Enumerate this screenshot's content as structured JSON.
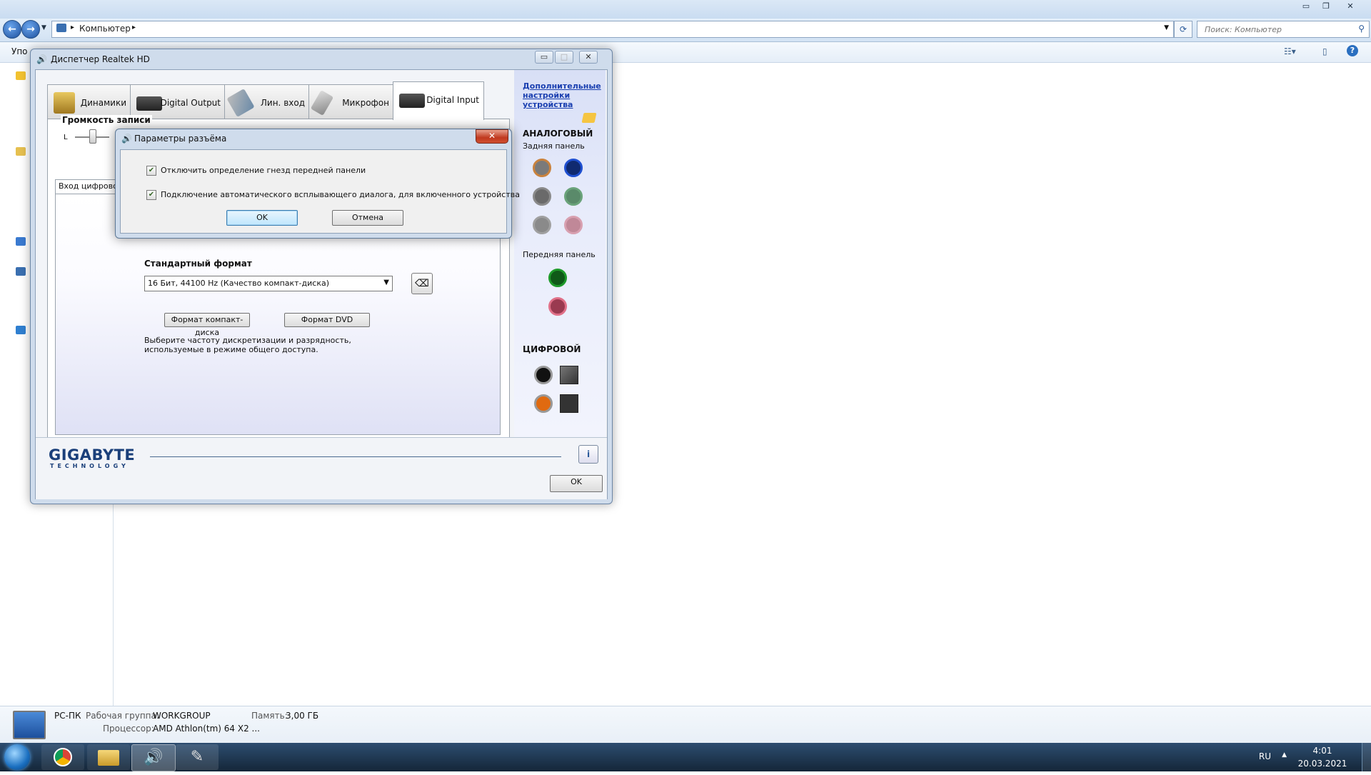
{
  "explorer": {
    "breadcrumb": "Компьютер",
    "search_placeholder": "Поиск: Компьютер",
    "command_partial": "Упо",
    "computer_name": "PC-ПК",
    "workgroup_label": "Рабочая группа:",
    "workgroup_value": "WORKGROUP",
    "memory_label": "Память:",
    "memory_value": "3,00 ГБ",
    "cpu_label": "Процессор:",
    "cpu_value": "AMD Athlon(tm) 64 X2 ..."
  },
  "realtek": {
    "title": "Диспетчер Realtek HD",
    "tabs": [
      {
        "label": "Динамики"
      },
      {
        "label": "Digital Output"
      },
      {
        "label": "Лин. вход"
      },
      {
        "label": "Микрофон"
      },
      {
        "label": "Digital Input"
      }
    ],
    "recording_volume_label": "Громкость записи",
    "volume_L": "L",
    "inner_tab_label": "Вход цифрового",
    "standard_format_label": "Стандартный формат",
    "format_value": "16 Бит, 44100 Hz (Качество компакт-диска)",
    "btn_cd_format": "Формат компакт-диска",
    "btn_dvd_format": "Формат DVD",
    "description": "Выберите частоту дискретизации и разрядность, используемые в режиме общего доступа.",
    "advanced_link": "Дополнительные настройки устройства",
    "analog_heading": "АНАЛОГОВЫЙ",
    "rear_panel": "Задняя панель",
    "front_panel": "Передняя панель",
    "digital_heading": "ЦИФРОВОЙ",
    "brand": "GIGABYTE",
    "brand_sub": "TECHNOLOGY",
    "ok_label": "OK"
  },
  "dialog": {
    "title": "Параметры разъёма",
    "checkbox1": {
      "label": "Отключить определение гнезд передней панели",
      "checked": true
    },
    "checkbox2": {
      "label": "Подключение автоматического всплывающего диалога, для включенного устройства",
      "checked": true
    },
    "ok_label": "OK",
    "cancel_label": "Отмена"
  },
  "taskbar": {
    "language": "RU",
    "time": "4:01",
    "date": "20.03.2021"
  },
  "colors": {
    "jack_orange": "#c9823e",
    "jack_blue": "#1f4fd0",
    "jack_gray": "#8a8a8a",
    "jack_green_dim": "#6aa37a",
    "jack_pink_dim": "#d8a0b0",
    "jack_green": "#1e9a2a",
    "jack_pink": "#e07088",
    "brand_blue": "#1a3f7a"
  }
}
